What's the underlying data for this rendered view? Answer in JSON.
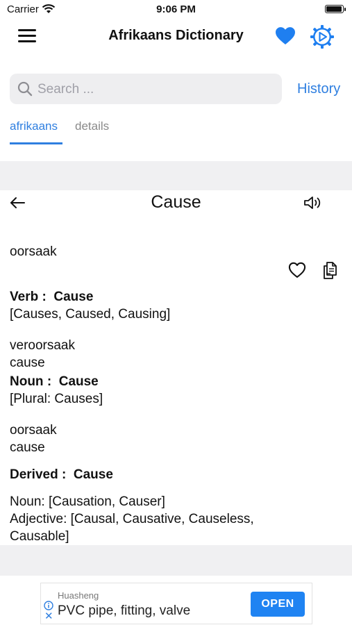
{
  "status_bar": {
    "carrier": "Carrier",
    "time": "9:06 PM",
    "battery_level": 0.95
  },
  "nav": {
    "title": "Afrikaans Dictionary"
  },
  "search": {
    "placeholder": "Search ...",
    "history_label": "History"
  },
  "tabs": [
    {
      "label": "afrikaans",
      "active": true
    },
    {
      "label": "details",
      "active": false
    }
  ],
  "entry": {
    "word": "Cause",
    "translation": "oorsaak",
    "sections": [
      {
        "label": "Verb :",
        "word": "Cause",
        "forms": "[Causes, Caused, Causing]",
        "translations": [
          "veroorsaak",
          "cause"
        ]
      },
      {
        "label": "Noun :",
        "word": "Cause",
        "forms": "[Plural: Causes]",
        "translations": [
          "oorsaak",
          "cause"
        ]
      }
    ],
    "derived": {
      "label": "Derived :",
      "word": "Cause",
      "noun": "Noun:  [Causation, Causer]",
      "adjective_line1": "Adjective:  [Causal, Causative, Causeless,",
      "adjective_line2": "Causable]"
    }
  },
  "ad": {
    "brand": "Huasheng",
    "text": "PVC pipe, fitting, valve",
    "button": "OPEN"
  },
  "colors": {
    "accent": "#2f7fe0",
    "band": "#f0f0f2",
    "ad_button": "#1f83f2"
  }
}
